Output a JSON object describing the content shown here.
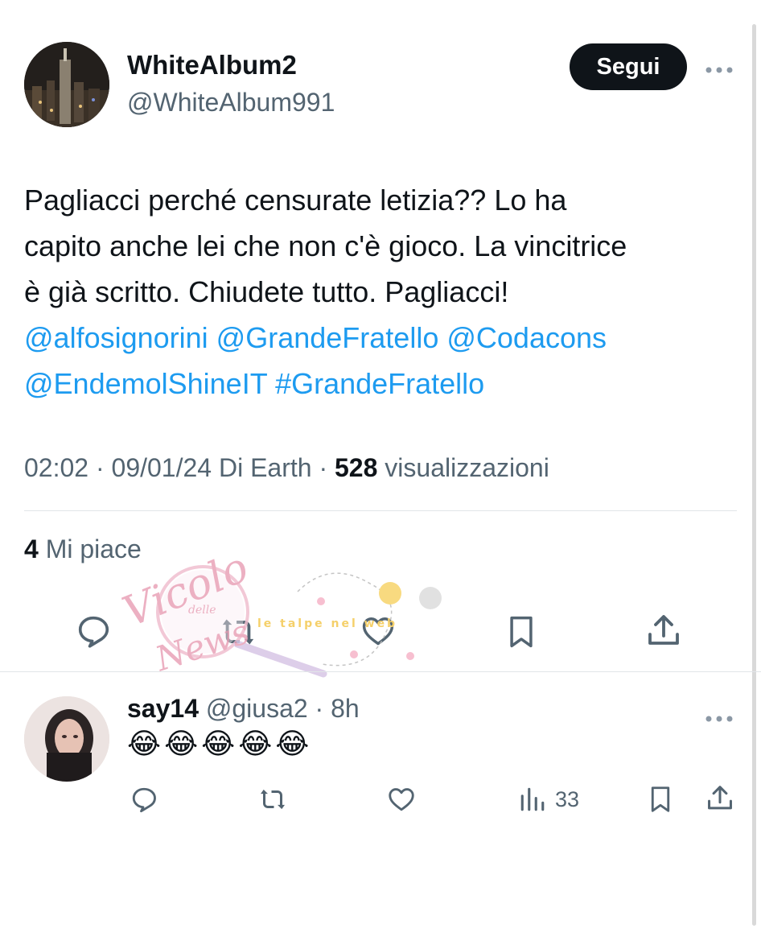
{
  "tweet": {
    "display_name": "WhiteAlbum2",
    "handle": "@WhiteAlbum991",
    "follow_label": "Segui",
    "more_icon": "more-horizontal-icon",
    "text_lines": [
      "Pagliacci perché censurate letizia?? Lo ha",
      "capito anche lei che non c'è gioco. La vincitrice",
      "è già scritto. Chiudete tutto. Pagliacci!"
    ],
    "mentions": {
      "m1": "@alfosignorini",
      "m2": "@GrandeFratello",
      "m3": "@Codacons",
      "m4": "@EndemolShineIT",
      "hashtag": "#GrandeFratello"
    },
    "meta_time": "02:02 · 09/01/24 Di Earth · ",
    "meta_views_count": "528",
    "meta_views_label": " visualizzazioni",
    "likes_count": "4",
    "likes_label": " Mi piace",
    "actions": [
      "reply-icon",
      "retweet-icon",
      "like-icon",
      "bookmark-icon",
      "share-icon"
    ]
  },
  "reply": {
    "name": "say14",
    "handle": "@giusa2",
    "time": " · 8h",
    "text": "😂😂😂😂😂",
    "views": "33",
    "actions": [
      "reply-icon",
      "retweet-icon",
      "like-icon",
      "views-icon",
      "bookmark-icon",
      "share-icon"
    ]
  },
  "watermark": {
    "title": "Vicolo",
    "small": "delle",
    "bottom": "News",
    "strip": "le talpe nel web"
  },
  "colors": {
    "link": "#1d9bf0",
    "text": "#0f1419",
    "muted": "#536471",
    "button_bg": "#0f1419"
  }
}
